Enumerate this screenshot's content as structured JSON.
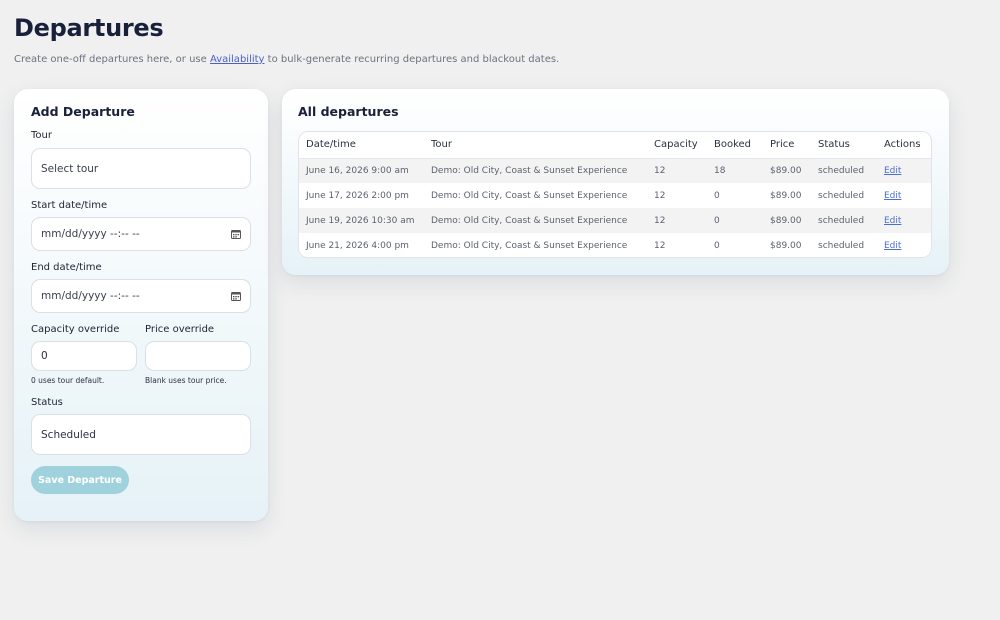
{
  "header": {
    "title": "Departures",
    "subtitle_before": "Create one-off departures here, or use ",
    "subtitle_link": "Availability",
    "subtitle_after": " to bulk-generate recurring departures and blackout dates."
  },
  "add_form": {
    "title": "Add Departure",
    "tour_label": "Tour",
    "tour_value": "Select tour",
    "start_label": "Start date/time",
    "start_placeholder": "mm/dd/yyyy --:-- --",
    "end_label": "End date/time",
    "end_placeholder": "mm/dd/yyyy --:-- --",
    "capacity_label": "Capacity override",
    "capacity_value": "0",
    "capacity_hint": "0 uses tour default.",
    "price_label": "Price override",
    "price_value": "",
    "price_hint": "Blank uses tour price.",
    "status_label": "Status",
    "status_value": "Scheduled",
    "save_label": "Save Departure"
  },
  "list": {
    "title": "All departures",
    "columns": [
      "Date/time",
      "Tour",
      "Capacity",
      "Booked",
      "Price",
      "Status",
      "Actions"
    ],
    "rows": [
      {
        "datetime": "June 16, 2026 9:00 am",
        "tour": "Demo: Old City, Coast & Sunset Experience",
        "capacity": "12",
        "booked": "18",
        "price": "$89.00",
        "status": "scheduled",
        "action": "Edit"
      },
      {
        "datetime": "June 17, 2026 2:00 pm",
        "tour": "Demo: Old City, Coast & Sunset Experience",
        "capacity": "12",
        "booked": "0",
        "price": "$89.00",
        "status": "scheduled",
        "action": "Edit"
      },
      {
        "datetime": "June 19, 2026 10:30 am",
        "tour": "Demo: Old City, Coast & Sunset Experience",
        "capacity": "12",
        "booked": "0",
        "price": "$89.00",
        "status": "scheduled",
        "action": "Edit"
      },
      {
        "datetime": "June 21, 2026 4:00 pm",
        "tour": "Demo: Old City, Coast & Sunset Experience",
        "capacity": "12",
        "booked": "0",
        "price": "$89.00",
        "status": "scheduled",
        "action": "Edit"
      }
    ]
  },
  "colors": {
    "background": "#f0f0f0",
    "link": "#4b5fc7",
    "save_button": "#9fd2dc",
    "edit_link": "#4b6fd0"
  },
  "icons": {
    "date_picker": "calendar-icon"
  }
}
